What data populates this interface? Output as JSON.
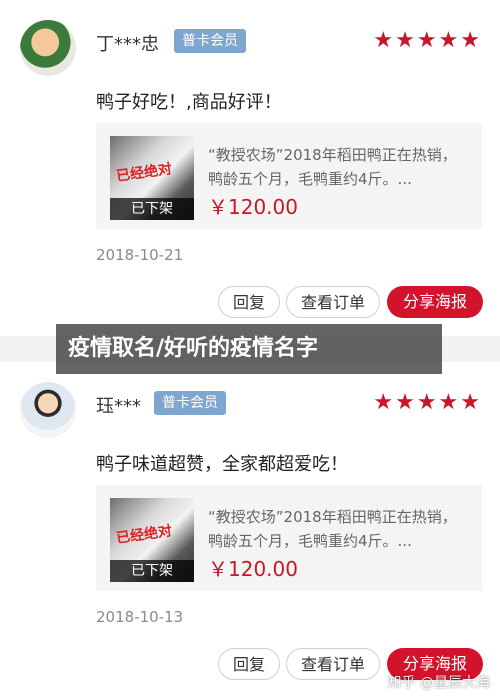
{
  "overlay_title": "疫情取名/好听的疫情名字",
  "watermark": "知乎 @星辰大海",
  "colors": {
    "accent": "#c8172b",
    "badge": "#7fa6cf",
    "button_primary": "#d2132b"
  },
  "reviews": [
    {
      "username": "丁***忠",
      "member_badge": "普卡会员",
      "rating": 5,
      "stars": "★★★★★",
      "text": "鸭子好吃！,商品好评！",
      "product": {
        "description": "“教授农场”2018年稻田鸭正在热销，鸭龄五个月，毛鸭重约4斤。...",
        "price": "￥120.00",
        "thumb_label": "已下架",
        "thumb_stamp": "已经绝对"
      },
      "date": "2018-10-21",
      "buttons": {
        "reply": "回复",
        "view_order": "查看订单",
        "share": "分享海报"
      }
    },
    {
      "username": "珏***",
      "member_badge": "普卡会员",
      "rating": 5,
      "stars": "★★★★★",
      "text": "鸭子味道超赞，全家都超爱吃！",
      "product": {
        "description": "“教授农场”2018年稻田鸭正在热销，鸭龄五个月，毛鸭重约4斤。...",
        "price": "￥120.00",
        "thumb_label": "已下架",
        "thumb_stamp": "已经绝对"
      },
      "date": "2018-10-13",
      "buttons": {
        "reply": "回复",
        "view_order": "查看订单",
        "share": "分享海报"
      }
    }
  ]
}
